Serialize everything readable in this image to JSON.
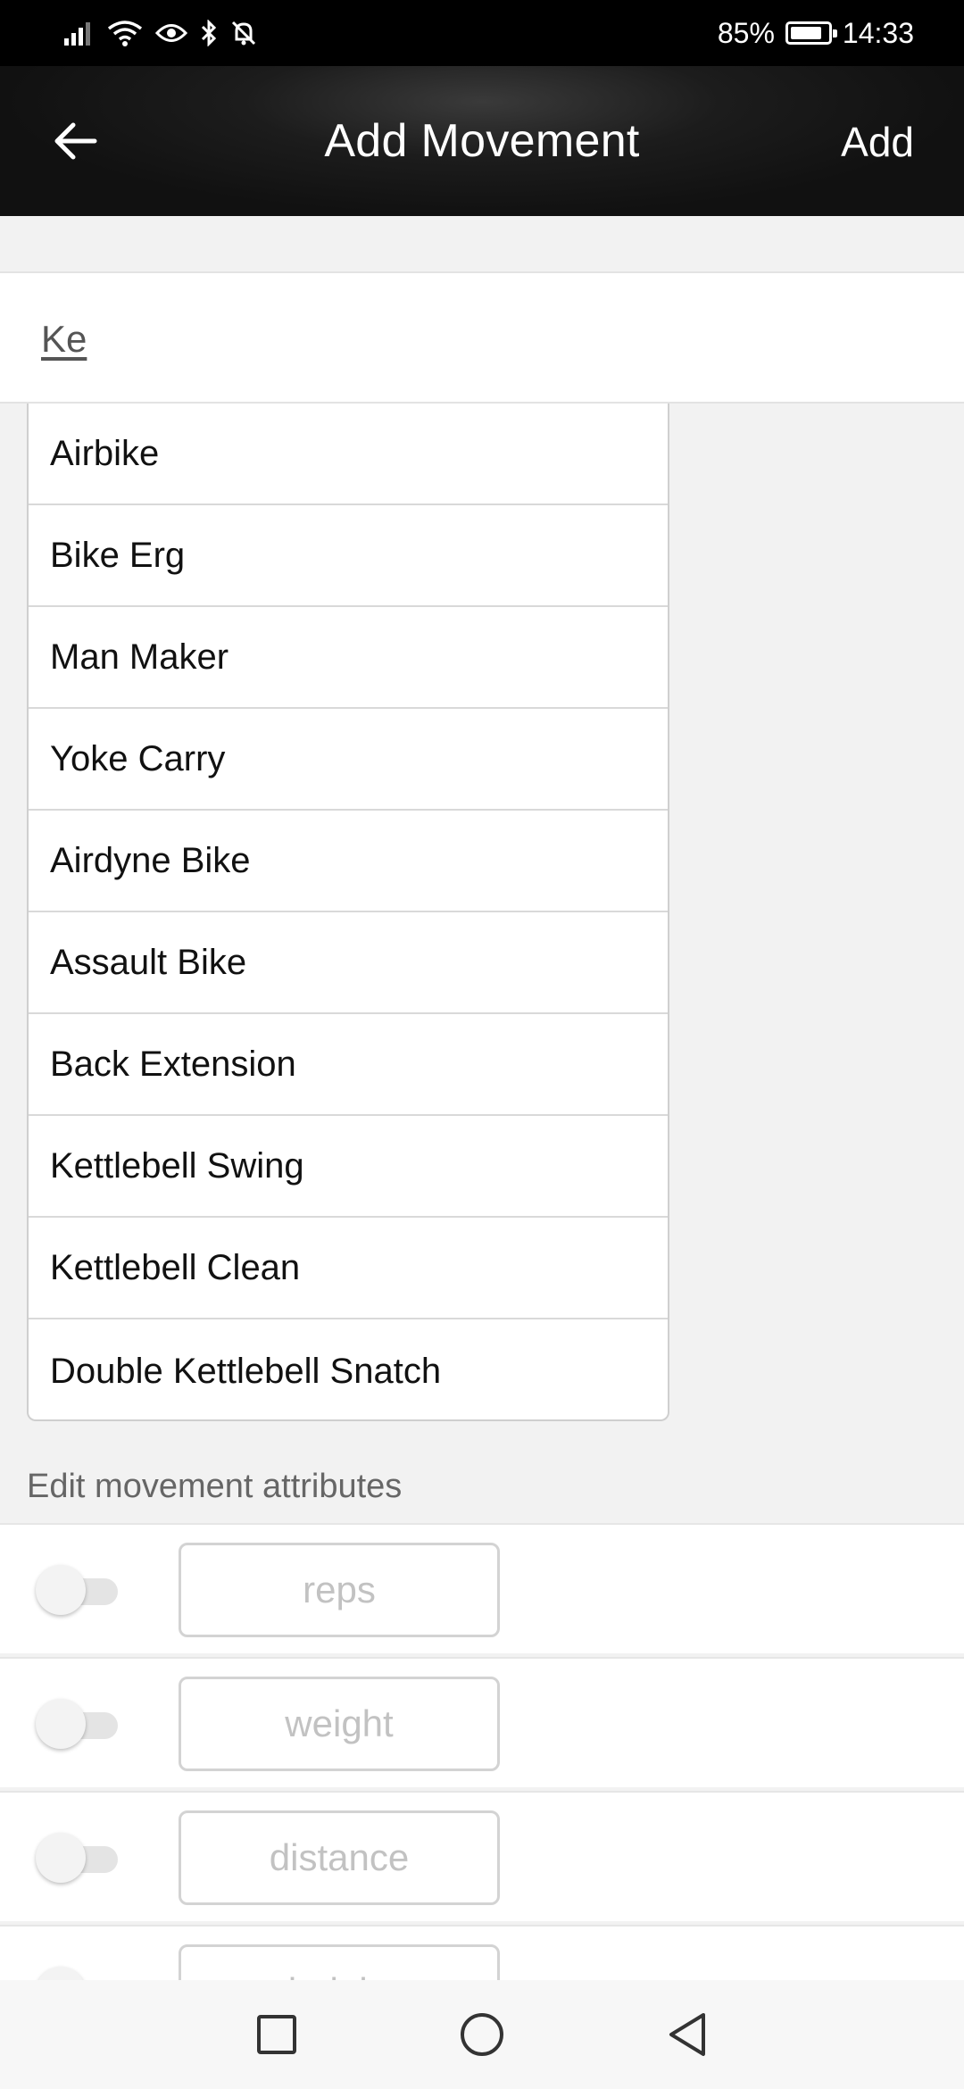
{
  "status_bar": {
    "battery": "85%",
    "battery_level": 0.85,
    "time": "14:33"
  },
  "app_bar": {
    "title": "Add Movement",
    "action_label": "Add",
    "back_icon": "arrow-left-icon"
  },
  "search": {
    "value": "Ke"
  },
  "suggestions": [
    "Airbike",
    "Bike Erg",
    "Man Maker",
    "Yoke Carry",
    "Airdyne Bike",
    "Assault Bike",
    "Back Extension",
    "Kettlebell Swing",
    "Kettlebell Clean",
    "Double Kettlebell Snatch"
  ],
  "attributes": {
    "section_label": "Edit movement attributes",
    "rows": [
      {
        "placeholder": "reps",
        "enabled": false
      },
      {
        "placeholder": "weight",
        "enabled": false
      },
      {
        "placeholder": "distance",
        "enabled": false
      },
      {
        "placeholder": "height",
        "enabled": false
      }
    ]
  },
  "nav_bar": {
    "icons": [
      "recents-square-icon",
      "home-circle-icon",
      "back-triangle-icon"
    ]
  },
  "colors": {
    "app_bar_bg": "#111111",
    "page_bg": "#f2f2f2",
    "placeholder_text": "#c2c2c2"
  }
}
